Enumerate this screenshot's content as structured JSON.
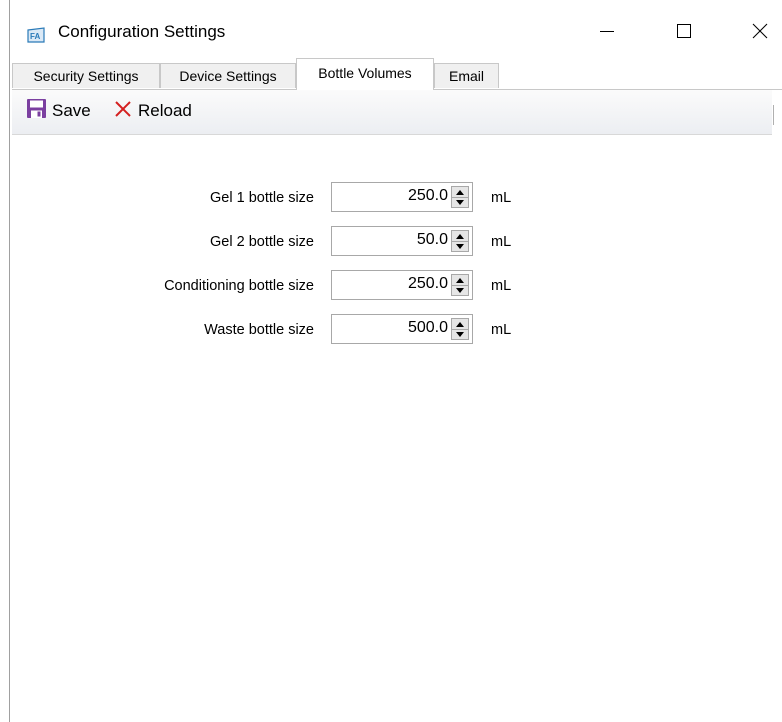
{
  "window": {
    "title": "Configuration Settings",
    "icon": "fa-app-icon",
    "controls": [
      "minimize-icon",
      "maximize-icon",
      "close-icon"
    ]
  },
  "tabs": [
    {
      "label": "Security Settings",
      "active": false
    },
    {
      "label": "Device Settings",
      "active": false
    },
    {
      "label": "Bottle Volumes",
      "active": true
    },
    {
      "label": "Email",
      "active": false
    }
  ],
  "toolbar": {
    "save_label": "Save",
    "reload_label": "Reload",
    "save_icon": "floppy-disk-icon",
    "reload_icon": "x-icon"
  },
  "fields": [
    {
      "label": "Gel 1 bottle size",
      "value": "250.0",
      "unit": "mL"
    },
    {
      "label": "Gel 2 bottle size",
      "value": "50.0",
      "unit": "mL"
    },
    {
      "label": "Conditioning bottle size",
      "value": "250.0",
      "unit": "mL"
    },
    {
      "label": "Waste bottle size",
      "value": "500.0",
      "unit": "mL"
    }
  ],
  "colors": {
    "save_icon": "#7b3fa0",
    "reload_icon": "#d42020",
    "app_icon": "#2a7ab8"
  }
}
